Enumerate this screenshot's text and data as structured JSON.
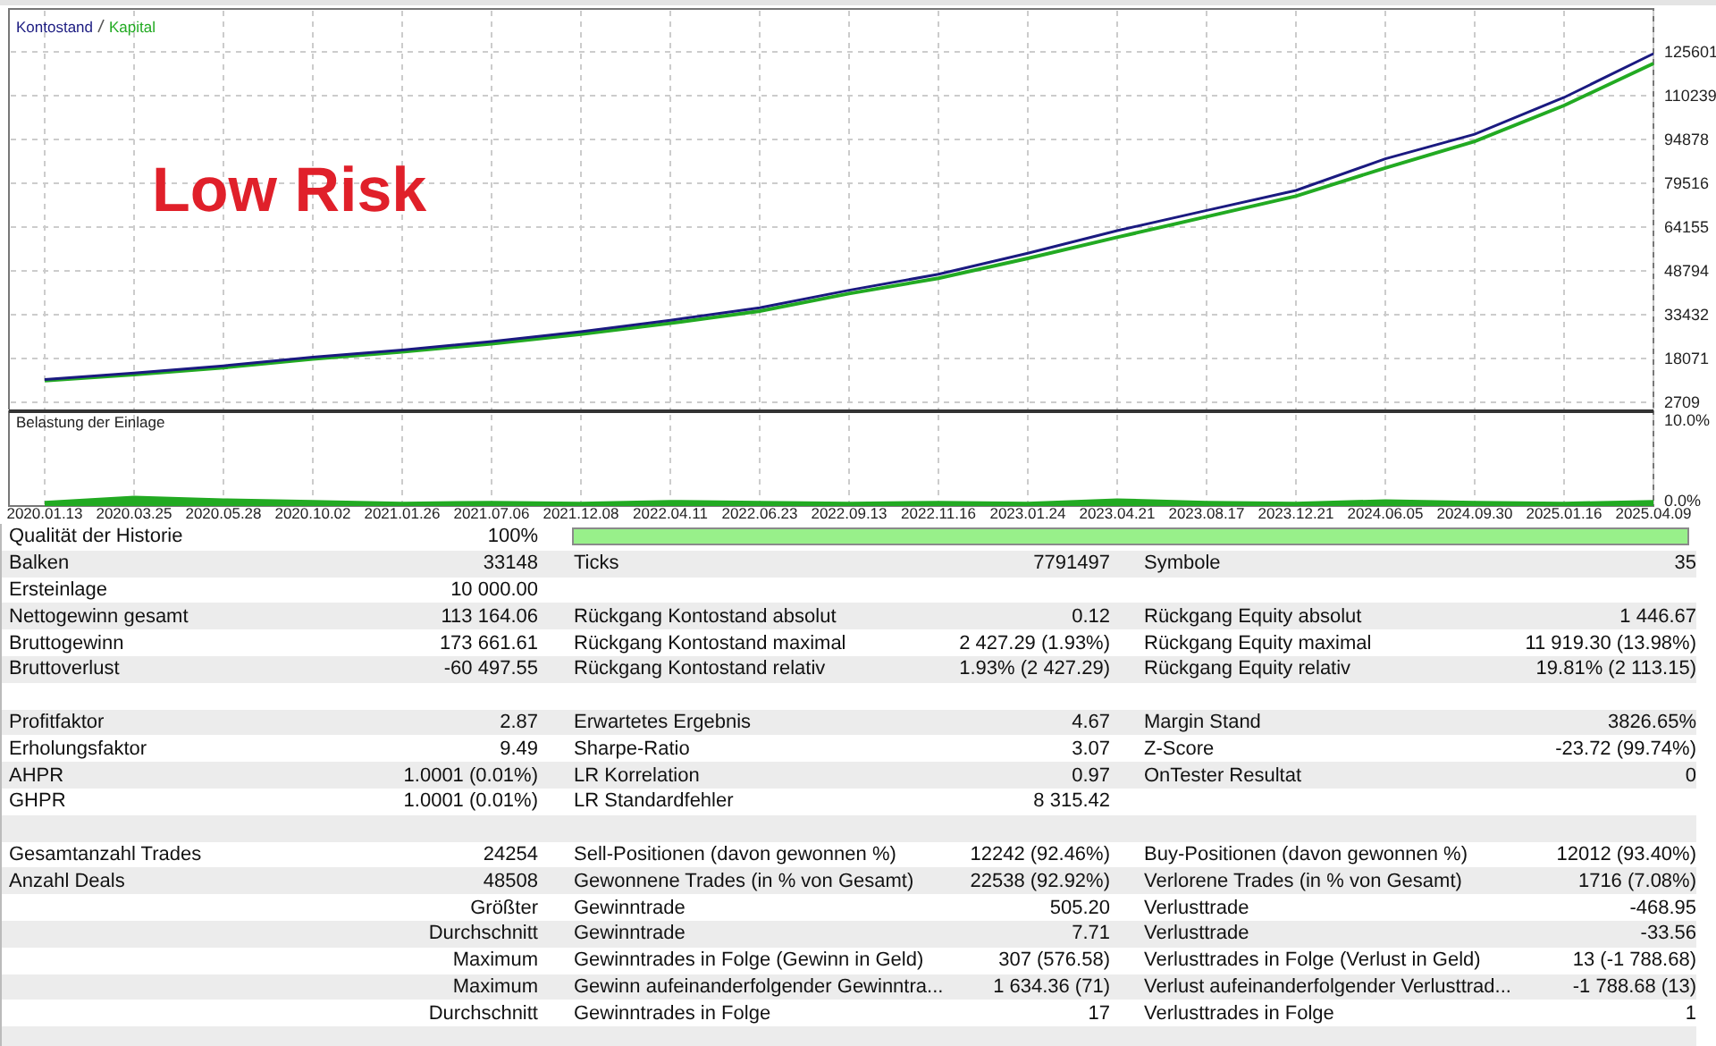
{
  "equity_chart": {
    "chart_data": {
      "type": "line",
      "grid": true,
      "ylim": [
        2709,
        125601
      ],
      "yticks": [
        2709,
        18071,
        33432,
        48794,
        64155,
        79516,
        94878,
        110239,
        125601
      ],
      "series": [
        {
          "name": "Kontostand",
          "color": "#1a1a80",
          "values": [
            10700,
            13000,
            15500,
            18500,
            21000,
            24000,
            27500,
            31500,
            35900,
            42000,
            47600,
            55000,
            62900,
            70000,
            77000,
            88100,
            96700,
            109600,
            125000
          ]
        },
        {
          "name": "Kapital",
          "color": "#22aa22",
          "values": [
            10300,
            12400,
            14900,
            17900,
            20400,
            23300,
            26600,
            30400,
            34700,
            40800,
            46200,
            53200,
            60600,
            67800,
            75000,
            84900,
            94200,
            106800,
            121500
          ]
        }
      ],
      "annotations": [
        {
          "text": "Low Risk"
        }
      ]
    }
  },
  "load_chart": {
    "chart_data": {
      "type": "area",
      "grid": true,
      "title": "Belastung der Einlage",
      "ylim": [
        0,
        10
      ],
      "yticks": [
        {
          "value": 0,
          "label": "0.0%"
        },
        {
          "value": 10,
          "label": "10.0%"
        }
      ],
      "categories": [
        "2020.01.13",
        "2020.03.25",
        "2020.05.28",
        "2020.10.02",
        "2021.01.26",
        "2021.07.06",
        "2021.12.08",
        "2022.04.11",
        "2022.06.23",
        "2022.09.13",
        "2022.11.16",
        "2023.01.24",
        "2023.04.21",
        "2023.08.17",
        "2023.12.21",
        "2024.06.05",
        "2024.09.30",
        "2025.01.16",
        "2025.04.09"
      ],
      "series": [
        {
          "color": "#22aa22",
          "values": [
            0.6,
            1.2,
            0.9,
            0.7,
            0.5,
            0.6,
            0.5,
            0.7,
            0.6,
            0.5,
            0.6,
            0.5,
            0.9,
            0.6,
            0.5,
            0.8,
            0.6,
            0.5,
            0.7
          ]
        }
      ]
    }
  },
  "report": {
    "rows": [
      {
        "kind": "quality",
        "label": "Qualität der Historie",
        "value": "100%",
        "level": 1
      },
      {
        "kind": "stats",
        "cells": [
          {
            "label": "Balken",
            "value": "33148"
          },
          {
            "label": "Ticks",
            "value": "7791497"
          },
          {
            "label": "Symbole",
            "value": "35"
          }
        ]
      },
      {
        "kind": "stats",
        "cells": [
          {
            "label": "Ersteinlage",
            "value": "10 000.00"
          }
        ]
      },
      {
        "kind": "stats",
        "cells": [
          {
            "label": "Nettogewinn gesamt",
            "value": "113 164.06"
          },
          {
            "label": "Rückgang Kontostand absolut",
            "value": "0.12"
          },
          {
            "label": "Rückgang Equity absolut",
            "value": "1 446.67"
          }
        ]
      },
      {
        "kind": "stats",
        "cells": [
          {
            "label": "Bruttogewinn",
            "value": "173 661.61"
          },
          {
            "label": "Rückgang Kontostand maximal",
            "value": "2 427.29 (1.93%)"
          },
          {
            "label": "Rückgang Equity maximal",
            "value": "11 919.30 (13.98%)"
          }
        ]
      },
      {
        "kind": "stats",
        "cells": [
          {
            "label": "Bruttoverlust",
            "value": "-60 497.55"
          },
          {
            "label": "Rückgang Kontostand relativ",
            "value": "1.93% (2 427.29)"
          },
          {
            "label": "Rückgang Equity relativ",
            "value": "19.81% (2 113.15)"
          }
        ]
      },
      {
        "kind": "spacer"
      },
      {
        "kind": "stats",
        "cells": [
          {
            "label": "Profitfaktor",
            "value": "2.87"
          },
          {
            "label": "Erwartetes Ergebnis",
            "value": "4.67"
          },
          {
            "label": "Margin Stand",
            "value": "3826.65%"
          }
        ]
      },
      {
        "kind": "stats",
        "cells": [
          {
            "label": "Erholungsfaktor",
            "value": "9.49"
          },
          {
            "label": "Sharpe-Ratio",
            "value": "3.07"
          },
          {
            "label": "Z-Score",
            "value": "-23.72 (99.74%)"
          }
        ]
      },
      {
        "kind": "stats",
        "cells": [
          {
            "label": "AHPR",
            "value": "1.0001 (0.01%)"
          },
          {
            "label": "LR Korrelation",
            "value": "0.97"
          },
          {
            "label": "OnTester Resultat",
            "value": "0"
          }
        ]
      },
      {
        "kind": "stats",
        "cells": [
          {
            "label": "GHPR",
            "value": "1.0001 (0.01%)"
          },
          {
            "label": "LR Standardfehler",
            "value": "8 315.42"
          }
        ]
      },
      {
        "kind": "spacer"
      },
      {
        "kind": "stats",
        "cells": [
          {
            "label": "Gesamtanzahl Trades",
            "value": "24254"
          },
          {
            "label": "Sell-Positionen (davon gewonnen %)",
            "value": "12242 (92.46%)"
          },
          {
            "label": "Buy-Positionen (davon gewonnen %)",
            "value": "12012 (93.40%)"
          }
        ]
      },
      {
        "kind": "stats",
        "cells": [
          {
            "label": "Anzahl Deals",
            "value": "48508"
          },
          {
            "label": "Gewonnene Trades (in % von Gesamt)",
            "value": "22538 (92.92%)"
          },
          {
            "label": "Verlorene Trades (in % von Gesamt)",
            "value": "1716 (7.08%)"
          }
        ]
      },
      {
        "kind": "stats",
        "cells": [
          {
            "value": "Größter"
          },
          {
            "label": "Gewinntrade",
            "value": "505.20"
          },
          {
            "label": "Verlusttrade",
            "value": "-468.95"
          }
        ]
      },
      {
        "kind": "stats",
        "cells": [
          {
            "value": "Durchschnitt"
          },
          {
            "label": "Gewinntrade",
            "value": "7.71"
          },
          {
            "label": "Verlusttrade",
            "value": "-33.56"
          }
        ]
      },
      {
        "kind": "stats",
        "cells": [
          {
            "value": "Maximum"
          },
          {
            "label": "Gewinntrades in Folge (Gewinn in Geld)",
            "value": "307 (576.58)"
          },
          {
            "label": "Verlusttrades in Folge (Verlust in Geld)",
            "value": "13 (-1 788.68)"
          }
        ]
      },
      {
        "kind": "stats",
        "cells": [
          {
            "value": "Maximum"
          },
          {
            "label": "Gewinn aufeinanderfolgender Gewinntra...",
            "value": "1 634.36 (71)"
          },
          {
            "label": "Verlust aufeinanderfolgender Verlusttrad...",
            "value": "-1 788.68 (13)"
          }
        ]
      },
      {
        "kind": "stats",
        "cells": [
          {
            "value": "Durchschnitt"
          },
          {
            "label": "Gewinntrades in Folge",
            "value": "17"
          },
          {
            "label": "Verlusttrades in Folge",
            "value": "1"
          }
        ]
      },
      {
        "kind": "spacer"
      }
    ]
  }
}
